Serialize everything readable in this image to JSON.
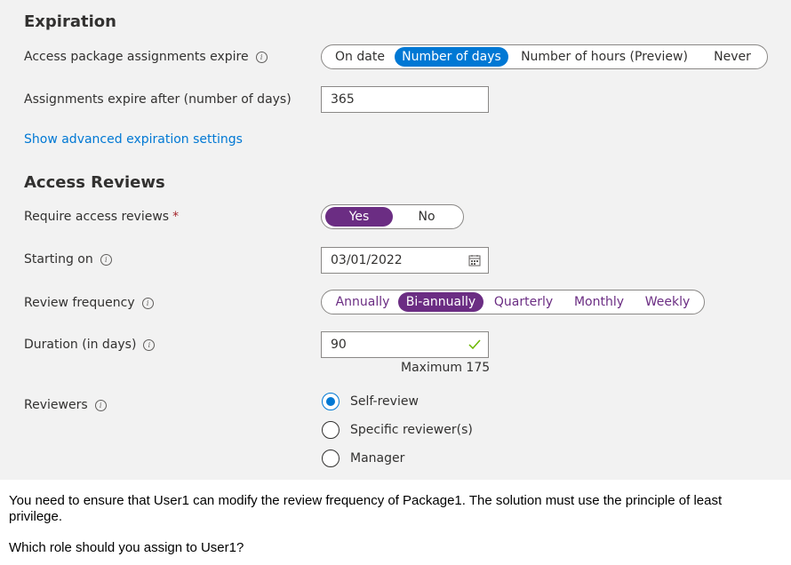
{
  "expiration": {
    "heading": "Expiration",
    "assignments_expire_label": "Access package assignments expire",
    "expire_options": [
      "On date",
      "Number of days",
      "Number of hours (Preview)",
      "Never"
    ],
    "expire_selected": "Number of days",
    "days_label": "Assignments expire after (number of days)",
    "days_value": "365",
    "advanced_link": "Show advanced expiration settings"
  },
  "access_reviews": {
    "heading": "Access Reviews",
    "require_label": "Require access reviews",
    "require_marker": "*",
    "require_options": [
      "Yes",
      "No"
    ],
    "require_selected": "Yes",
    "starting_label": "Starting on",
    "starting_value": "03/01/2022",
    "frequency_label": "Review frequency",
    "frequency_options": [
      "Annually",
      "Bi-annually",
      "Quarterly",
      "Monthly",
      "Weekly"
    ],
    "frequency_selected": "Bi-annually",
    "duration_label": "Duration (in days)",
    "duration_value": "90",
    "duration_hint": "Maximum 175",
    "reviewers_label": "Reviewers",
    "reviewer_options": [
      "Self-review",
      "Specific reviewer(s)",
      "Manager"
    ],
    "reviewer_selected": "Self-review"
  },
  "question": {
    "line1": "You need to ensure that User1 can modify the review frequency of Package1. The solution must use the principle of least",
    "line2": "privilege.",
    "line3": "Which role should you assign to User1?"
  },
  "icons": {
    "info": "i",
    "calendar": "calendar-icon",
    "valid": "checkmark-icon"
  },
  "colors": {
    "blue_accent": "#0078d4",
    "purple_accent": "#6b2d83",
    "panel_bg": "#f2f2f2"
  }
}
